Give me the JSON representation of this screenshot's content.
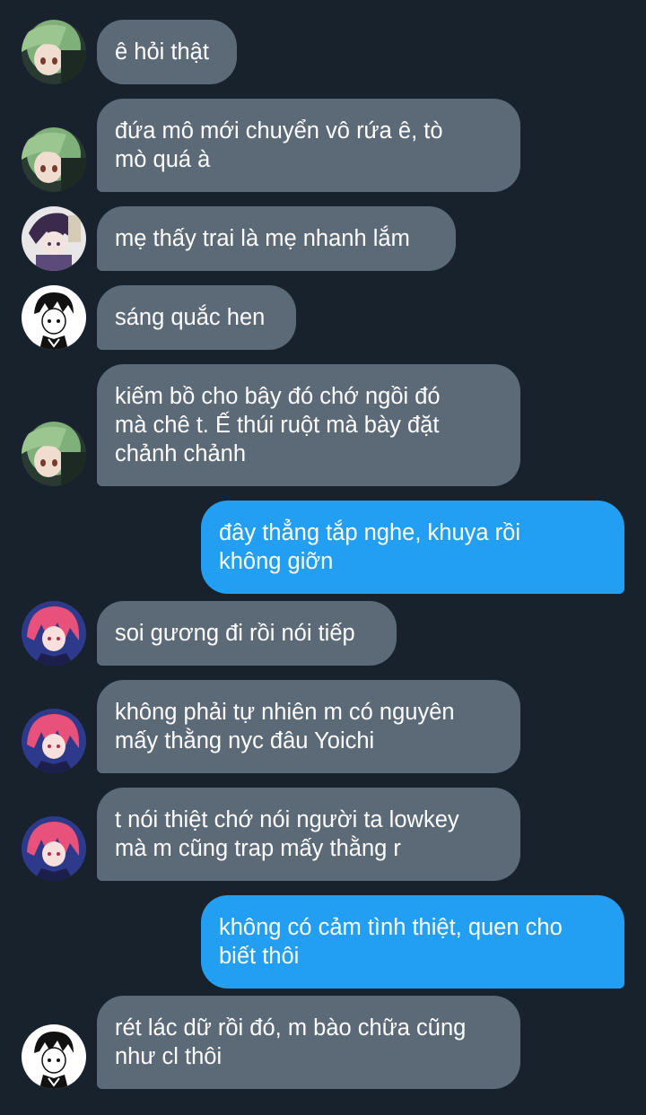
{
  "messages": [
    {
      "text": "ê hỏi thật",
      "direction": "in",
      "avatar": "green-hair-girl-avatar"
    },
    {
      "text": "đứa mô mới chuyển vô rứa ê, tò\nmò quá à",
      "direction": "in",
      "avatar": "green-hair-girl-avatar"
    },
    {
      "text": "mẹ thấy trai là mẹ nhanh lắm",
      "direction": "in",
      "avatar": "purple-hair-boy-avatar"
    },
    {
      "text": "sáng quắc hen",
      "direction": "in",
      "avatar": "black-white-sketch-avatar"
    },
    {
      "text": "kiếm bồ cho bây đó chớ ngồi đó\nmà chê t. Ế thúi ruột mà bày đặt\nchảnh chảnh",
      "direction": "in",
      "avatar": "green-hair-girl-avatar"
    },
    {
      "text": "đây thẳng tắp nghe, khuya rồi\nkhông giỡn",
      "direction": "out"
    },
    {
      "text": "soi gương đi rồi nói tiếp",
      "direction": "in",
      "avatar": "red-hair-girl-avatar"
    },
    {
      "text": "không phải tự nhiên m có nguyên\nmấy thằng nyc đâu Yoichi",
      "direction": "in",
      "avatar": "red-hair-girl-avatar"
    },
    {
      "text": "t nói thiệt chớ nói người ta lowkey\nmà m cũng trap mấy thằng r",
      "direction": "in",
      "avatar": "red-hair-girl-avatar"
    },
    {
      "text": "không có cảm tình thiệt, quen cho\nbiết thôi",
      "direction": "out"
    },
    {
      "text": "rét lác dữ rồi đó, m bào chữa cũng\nnhư cl thôi",
      "direction": "in",
      "avatar": "black-white-sketch-avatar"
    }
  ],
  "colors": {
    "background": "#18222d",
    "incoming_bubble": "#5c6a78",
    "outgoing_bubble": "#229ff2",
    "text": "#ffffff"
  }
}
